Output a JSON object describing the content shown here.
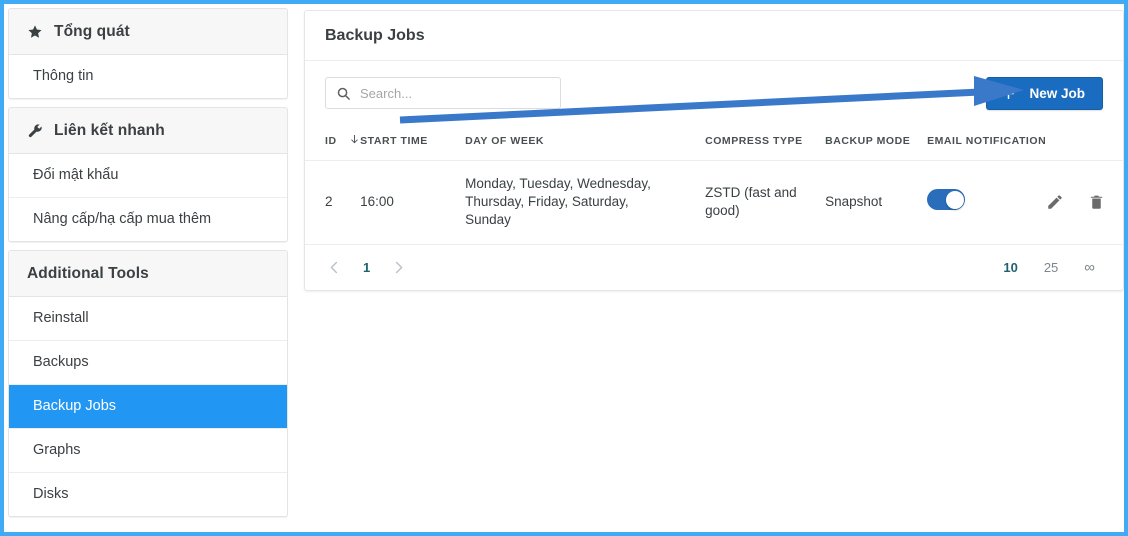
{
  "sidebar": {
    "sections": [
      {
        "title": "Tổng quát",
        "icon": "star-icon",
        "items": [
          {
            "label": "Thông tin",
            "active": false
          }
        ]
      },
      {
        "title": "Liên kết nhanh",
        "icon": "wrench-icon",
        "items": [
          {
            "label": "Đổi mật khẩu",
            "active": false
          },
          {
            "label": "Nâng cấp/hạ cấp mua thêm",
            "active": false
          }
        ]
      },
      {
        "title": "Additional Tools",
        "icon": "none",
        "items": [
          {
            "label": "Reinstall",
            "active": false
          },
          {
            "label": "Backups",
            "active": false
          },
          {
            "label": "Backup Jobs",
            "active": true
          },
          {
            "label": "Graphs",
            "active": false
          },
          {
            "label": "Disks",
            "active": false
          }
        ]
      }
    ]
  },
  "main": {
    "title": "Backup Jobs",
    "search": {
      "value": "",
      "placeholder": "Search...",
      "icon": "search-icon"
    },
    "new_job": {
      "label": "New Job",
      "icon": "plus-icon"
    },
    "table": {
      "columns": [
        "ID",
        "START TIME",
        "DAY OF WEEK",
        "COMPRESS TYPE",
        "BACKUP MODE",
        "EMAIL NOTIFICATION",
        ""
      ],
      "sort_column": "ID",
      "sort_direction": "desc",
      "rows": [
        {
          "id": "2",
          "start_time": "16:00",
          "day_of_week": "Monday, Tuesday, Wednesday, Thursday, Friday, Saturday, Sunday",
          "compress_type": "ZSTD (fast and good)",
          "backup_mode": "Snapshot",
          "email_notification": true,
          "edit_icon": "pencil-icon",
          "delete_icon": "trash-icon"
        }
      ]
    },
    "pagination": {
      "prev": "‹",
      "next": "›",
      "current_page": "1",
      "page_sizes": [
        {
          "label": "10",
          "active": true
        },
        {
          "label": "25",
          "active": false
        },
        {
          "label": "∞",
          "active": false
        }
      ]
    }
  },
  "annotation": {
    "type": "arrow",
    "color": "#3a78c9",
    "points_to": "new-job-button"
  },
  "colors": {
    "accent_blue": "#2196f3",
    "button_blue": "#1a6cc0",
    "toggle_blue": "#2a6ebb",
    "frame_blue": "#41aaf4",
    "text": "#3b4043"
  }
}
